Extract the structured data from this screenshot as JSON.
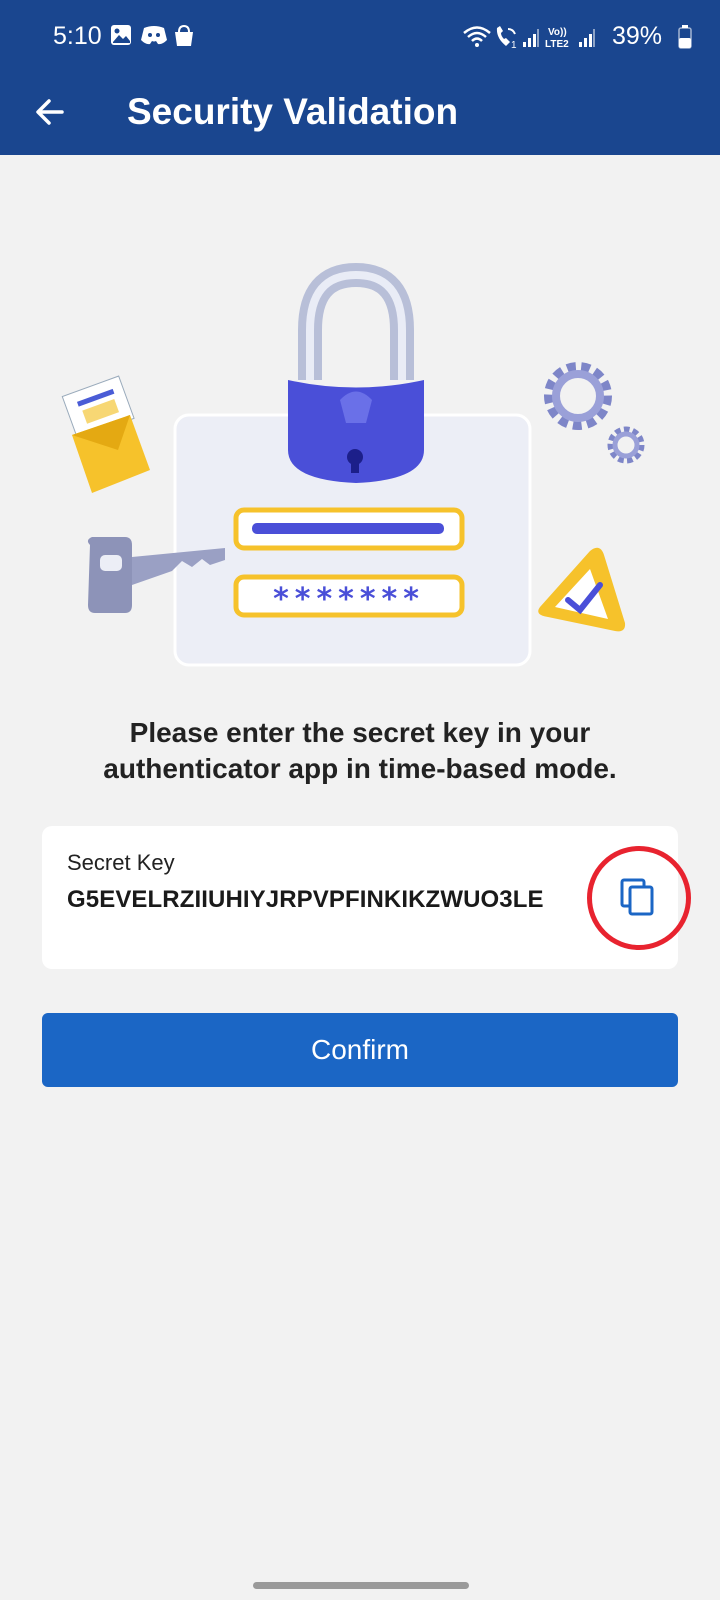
{
  "status_bar": {
    "time": "5:10",
    "battery": "39%",
    "icons": [
      "gallery-icon",
      "discord-icon",
      "shopping-bag-icon",
      "wifi-icon",
      "wifi-calling-icon",
      "signal-icon",
      "volte-icon",
      "signal-icon",
      "battery-icon"
    ],
    "volte_label": "Vo)) LTE2"
  },
  "header": {
    "title": "Security Validation",
    "back_icon": "arrow-left-icon",
    "background": "#1a468f"
  },
  "main": {
    "illustration": "padlock-password-card-illustration",
    "password_mask": "*******",
    "instruction": "Please enter the secret key in your authenticator app in time-based mode.",
    "secret_key": {
      "label": "Secret Key",
      "value": "G5EVELRZIIUHIYJRPVPFINKIKZWUO3LE",
      "copy_icon": "copy-icon"
    },
    "confirm_button": {
      "label": "Confirm",
      "color": "#1b66c5"
    }
  }
}
